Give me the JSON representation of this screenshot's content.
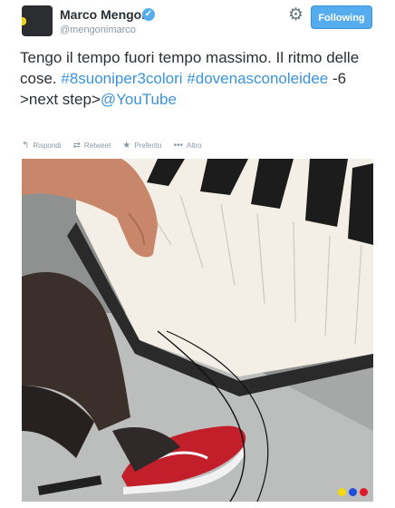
{
  "user": {
    "display_name": "Marco Mengoni",
    "screen_name": "@mengonimarco",
    "verified_glyph": "✓"
  },
  "header": {
    "settings_icon": "gear-icon",
    "follow_label": "Following"
  },
  "tweet": {
    "text_1": "Tengo il tempo fuori tempo massimo. Il ritmo delle cose. ",
    "hashtag_1": "#8suoniper3colori",
    "hashtag_2": "#dovenasconoleidee",
    "text_2": " -6 >next step>",
    "mention": "@YouTube"
  },
  "actions": {
    "reply": "Rispondi",
    "retweet": "Retweet",
    "favorite": "Preferito",
    "more": "Altro"
  },
  "media": {
    "description_icon": "photo-piano-sneaker",
    "flag_colors": [
      "#f5d90a",
      "#1d4fd8",
      "#e0192c"
    ]
  },
  "colors": {
    "accent": "#55acee",
    "link": "#3b94d9",
    "muted": "#8899a6"
  }
}
